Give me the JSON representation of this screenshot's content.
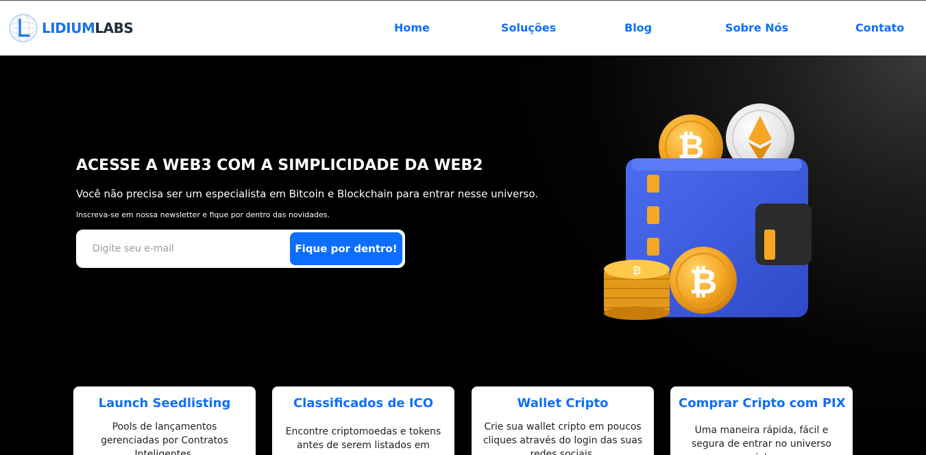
{
  "brand": {
    "logo_part1": "LIDIUM",
    "logo_part2": "LABS"
  },
  "nav": {
    "items": [
      {
        "label": "Home"
      },
      {
        "label": "Soluções"
      },
      {
        "label": "Blog"
      },
      {
        "label": "Sobre Nós"
      },
      {
        "label": "Contato"
      }
    ]
  },
  "hero": {
    "title": "ACESSE A WEB3 COM A SIMPLICIDADE DA WEB2",
    "subtitle": "Você não precisa ser um especialista em Bitcoin e Blockchain para entrar nesse universo.",
    "newsletter_text": "Inscreva-se em nossa newsletter e fique por dentro das novidades.",
    "email_placeholder": "Digite seu e-mail",
    "email_value": "",
    "cta_label": "Fique por dentro!",
    "illustration_icons": [
      "wallet-icon",
      "bitcoin-coin-icon",
      "ethereum-coin-icon",
      "coin-stack-icon"
    ]
  },
  "cards": [
    {
      "title": "Launch Seedlisting",
      "text": "Pools de lançamentos gerenciadas por Contratos Inteligentes."
    },
    {
      "title": "Classificados de ICO",
      "text": "Encontre criptomoedas e tokens antes de serem listados em"
    },
    {
      "title": "Wallet Cripto",
      "text": "Crie sua wallet cripto em poucos cliques através do login das suas redes sociais."
    },
    {
      "title": "Comprar Cripto com PIX",
      "text": "Uma maneira rápida, fácil e segura de entrar no universo cripto."
    }
  ],
  "colors": {
    "accent": "#0d6efd",
    "header_bg": "#ffffff",
    "hero_bg": "#000000",
    "wallet": "#3b5de0",
    "coin": "#f5a623",
    "coin_silver": "#e6e6e6"
  }
}
